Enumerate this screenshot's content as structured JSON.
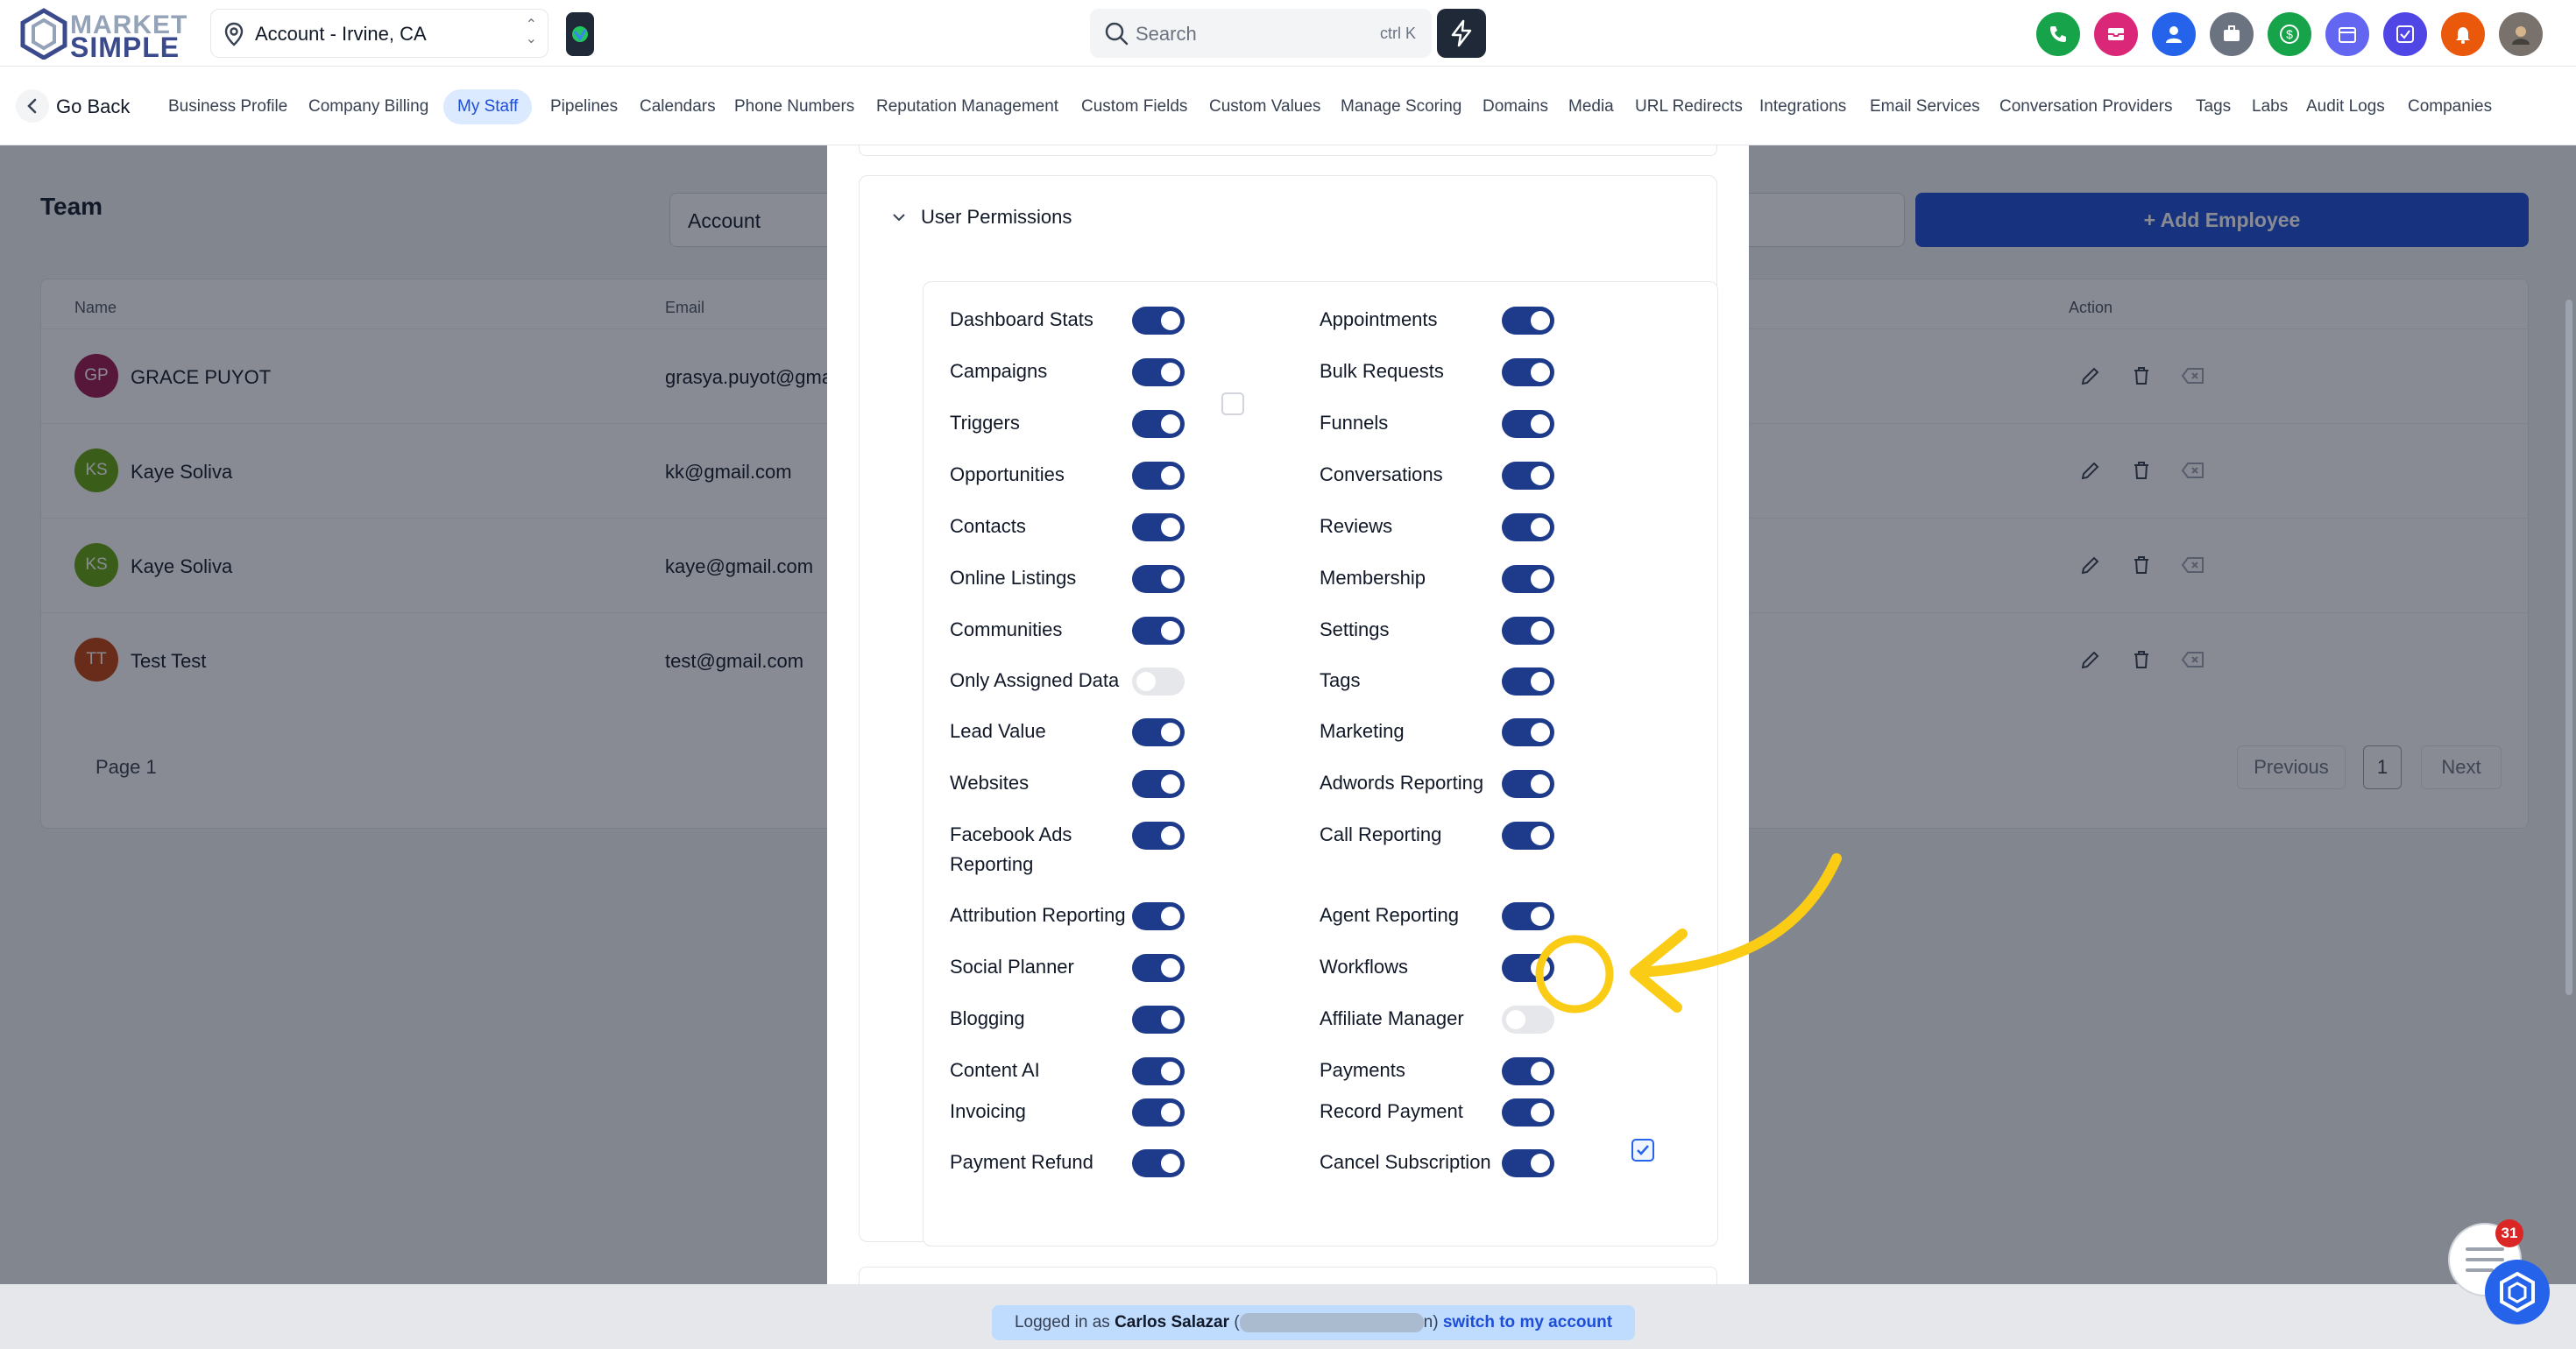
{
  "topbar": {
    "logo_line1": "MARKET",
    "logo_line2": "SIMPLE",
    "account": "Account - Irvine, CA",
    "search_placeholder": "Search",
    "search_shortcut": "ctrl K"
  },
  "colors": {
    "primary": "#1d4ed8",
    "toggle_on": "#1e3a8a",
    "highlight": "#facc15",
    "circle_icons": [
      "#16a34a",
      "#db2777",
      "#2563eb",
      "#6b7280",
      "#16a34a",
      "#6366f1",
      "#4f46e5",
      "#ea580c"
    ]
  },
  "nav": {
    "back_label": "Go Back",
    "tabs": [
      "Business Profile",
      "Company Billing",
      "My Staff",
      "Pipelines",
      "Calendars",
      "Phone Numbers",
      "Reputation Management",
      "Custom Fields",
      "Custom Values",
      "Manage Scoring",
      "Domains",
      "Media",
      "URL Redirects",
      "Integrations",
      "Email Services",
      "Conversation Providers",
      "Tags",
      "Labs",
      "Audit Logs",
      "Companies"
    ],
    "active_tab": "My Staff"
  },
  "team": {
    "title": "Team",
    "filter_value": "Account",
    "add_button": "+ Add Employee",
    "columns": {
      "name": "Name",
      "email": "Email",
      "action": "Action"
    },
    "rows": [
      {
        "initials": "GP",
        "name": "GRACE PUYOT",
        "email": "grasya.puyot@gma",
        "color": "#9d174d"
      },
      {
        "initials": "KS",
        "name": "Kaye Soliva",
        "email": "kk@gmail.com",
        "color": "#65a30d"
      },
      {
        "initials": "KS",
        "name": "Kaye Soliva",
        "email": "kaye@gmail.com",
        "color": "#65a30d"
      },
      {
        "initials": "TT",
        "name": "Test Test",
        "email": "test@gmail.com",
        "color": "#c2410c"
      }
    ],
    "page_label": "Page 1",
    "prev": "Previous",
    "page_num": "1",
    "next": "Next"
  },
  "permissions": {
    "section_title": "User Permissions",
    "left": [
      {
        "label": "Dashboard Stats",
        "on": true
      },
      {
        "label": "Campaigns",
        "on": true
      },
      {
        "label": "Triggers",
        "on": true
      },
      {
        "label": "Opportunities",
        "on": true
      },
      {
        "label": "Contacts",
        "on": true
      },
      {
        "label": "Online Listings",
        "on": true
      },
      {
        "label": "Communities",
        "on": true
      },
      {
        "label": "Only Assigned Data",
        "on": false
      },
      {
        "label": "Lead Value",
        "on": true
      },
      {
        "label": "Websites",
        "on": true
      },
      {
        "label": "Facebook Ads Reporting",
        "on": true
      },
      {
        "label": "Attribution Reporting",
        "on": true
      },
      {
        "label": "Social Planner",
        "on": true
      },
      {
        "label": "Blogging",
        "on": true
      },
      {
        "label": "Content AI",
        "on": true
      },
      {
        "label": "Invoicing",
        "on": true
      },
      {
        "label": "Payment Refund",
        "on": true
      }
    ],
    "right": [
      {
        "label": "Appointments",
        "on": true
      },
      {
        "label": "Bulk Requests",
        "on": true
      },
      {
        "label": "Funnels",
        "on": true
      },
      {
        "label": "Conversations",
        "on": true
      },
      {
        "label": "Reviews",
        "on": true
      },
      {
        "label": "Membership",
        "on": true
      },
      {
        "label": "Settings",
        "on": true
      },
      {
        "label": "Tags",
        "on": true
      },
      {
        "label": "Marketing",
        "on": true
      },
      {
        "label": "Adwords Reporting",
        "on": true
      },
      {
        "label": "Call Reporting",
        "on": true
      },
      {
        "label": "Agent Reporting",
        "on": true
      },
      {
        "label": "Workflows",
        "on": true
      },
      {
        "label": "Affiliate Manager",
        "on": false
      },
      {
        "label": "Payments",
        "on": true
      },
      {
        "label": "Record Payment",
        "on": true
      },
      {
        "label": "Cancel Subscription",
        "on": true
      }
    ],
    "campaigns_checkbox_checked": false,
    "workflows_checkbox_checked": true
  },
  "footer": {
    "logged_prefix": "Logged in as",
    "user": "Carlos Salazar",
    "open": "(",
    "close": "n)",
    "switch_label": "switch to my account"
  },
  "chat": {
    "badge": "31"
  }
}
